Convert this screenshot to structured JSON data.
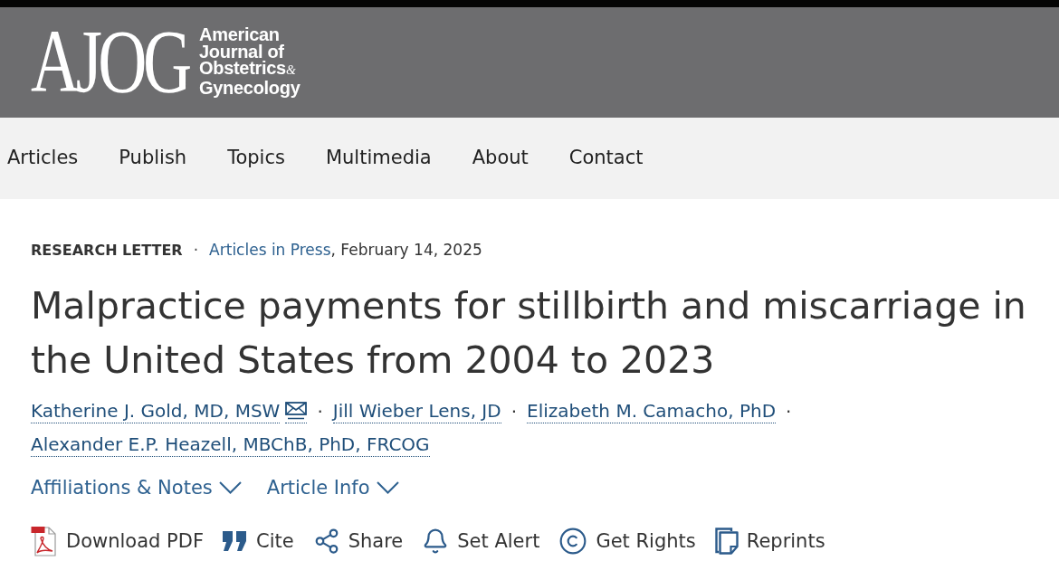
{
  "header": {
    "logo": {
      "monogram": "AJOG",
      "name_lines": [
        {
          "text": "American"
        },
        {
          "text": "Journal of"
        },
        {
          "text": "Obstetrics",
          "suffix": "&"
        },
        {
          "text": "Gynecology"
        }
      ]
    }
  },
  "nav": {
    "items": [
      "Articles",
      "Publish",
      "Topics",
      "Multimedia",
      "About",
      "Contact"
    ]
  },
  "article": {
    "meta": {
      "article_type": "RESEARCH LETTER",
      "separator": "·",
      "issue_link": "Articles in Press",
      "date": ", February 14, 2025"
    },
    "title": "Malpractice payments for stillbirth and miscarriage in the United States from 2004 to 2023",
    "authors": [
      {
        "name": "Katherine J. Gold, MD, MSW",
        "email": true,
        "separator": "·"
      },
      {
        "name": "Jill Wieber Lens, JD",
        "email": false,
        "separator": "·"
      },
      {
        "name": "Elizabeth M. Camacho, PhD",
        "email": false,
        "separator": "·"
      },
      {
        "name": "Alexander E.P. Heazell, MBChB, PhD, FRCOG",
        "email": false
      }
    ],
    "expanders": [
      {
        "label": "Affiliations & Notes",
        "expanded": false
      },
      {
        "label": "Article Info",
        "expanded": false
      }
    ],
    "actions": [
      {
        "kind": "pdf",
        "label": "Download PDF"
      },
      {
        "kind": "cite",
        "label": "Cite"
      },
      {
        "kind": "share",
        "label": "Share"
      },
      {
        "kind": "alert",
        "label": "Set Alert"
      },
      {
        "kind": "rights",
        "label": "Get Rights"
      },
      {
        "kind": "reprints",
        "label": "Reprints"
      }
    ]
  }
}
